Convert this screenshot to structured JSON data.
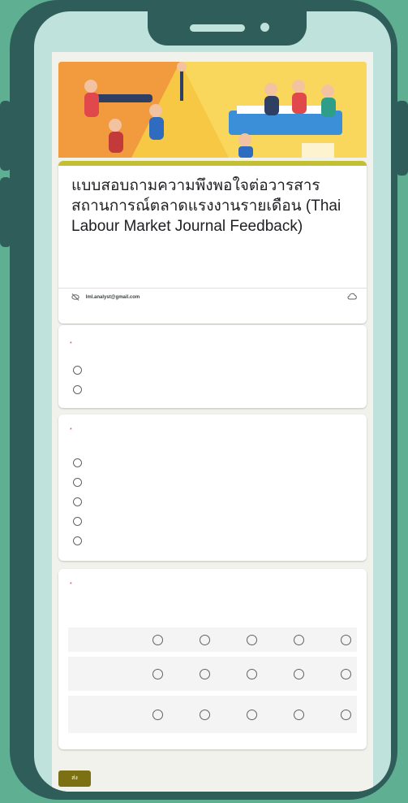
{
  "form": {
    "title": "แบบสอบถามความพึงพอใจต่อวารสารสถานการณ์ตลาดแรงงานรายเดือน (Thai Labour Market Journal Feedback)",
    "description": "",
    "account_email": "lml.analyst@gmail.com",
    "account_note": "",
    "switch_account": "",
    "required_note": ""
  },
  "q1": {
    "title": "",
    "required_mark": "*",
    "options": [
      "",
      ""
    ]
  },
  "q2": {
    "title": "",
    "required_mark": "*",
    "options": [
      "",
      "",
      "",
      "",
      ""
    ]
  },
  "q3": {
    "title": "",
    "required_mark": "*",
    "columns": [
      "",
      "",
      "",
      "",
      ""
    ],
    "rows": [
      "",
      "",
      ""
    ]
  },
  "actions": {
    "submit_label": "ส่ง",
    "clear_label": ""
  },
  "colors": {
    "background": "#5faf92",
    "phone_frame": "#2f5d59",
    "accent": "#c3bf33",
    "submit": "#7c7014"
  }
}
